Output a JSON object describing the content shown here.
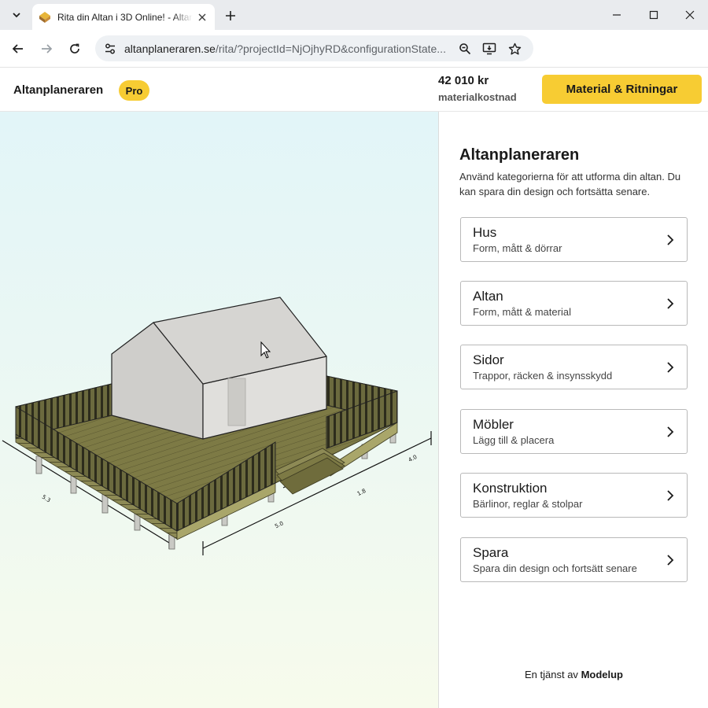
{
  "browser": {
    "tab_title": "Rita din Altan i 3D Online! - Altanplaneraren",
    "url_host": "altanplaneraren.se",
    "url_path": "/rita/?projectId=NjOjhyRD&configurationState..."
  },
  "header": {
    "brand": "Altanplaneraren",
    "badge": "Pro",
    "price": "42 010 kr",
    "price_label": "materialkostnad",
    "cta_label": "Material & Ritningar"
  },
  "panel": {
    "title": "Altanplaneraren",
    "description": "Använd kategorierna för att utforma din altan. Du kan spara din design och fortsätta senare.",
    "categories": [
      {
        "title": "Hus",
        "subtitle": "Form, mått & dörrar"
      },
      {
        "title": "Altan",
        "subtitle": "Form, mått & material"
      },
      {
        "title": "Sidor",
        "subtitle": "Trappor, räcken & insynsskydd"
      },
      {
        "title": "Möbler",
        "subtitle": "Lägg till & placera"
      },
      {
        "title": "Konstruktion",
        "subtitle": "Bärlinor, reglar & stolpar"
      },
      {
        "title": "Spara",
        "subtitle": "Spara din design och fortsätt senare"
      }
    ],
    "footer_prefix": "En tjänst av",
    "footer_brand": "Modelup"
  },
  "colors": {
    "accent": "#f7cc33",
    "deck": "#7d7a45",
    "house": "#d9d8d5"
  },
  "icons": {
    "tab_search": "chevron-down-icon",
    "favicon": "altan-logo-icon",
    "close": "close-icon",
    "new_tab": "plus-icon",
    "back": "arrow-left-icon",
    "forward": "arrow-right-icon",
    "reload": "reload-icon",
    "site_info": "tune-icon",
    "zoom": "zoom-icon",
    "install": "install-app-icon",
    "bookmark": "star-icon",
    "chevron": "chevron-right-icon"
  }
}
